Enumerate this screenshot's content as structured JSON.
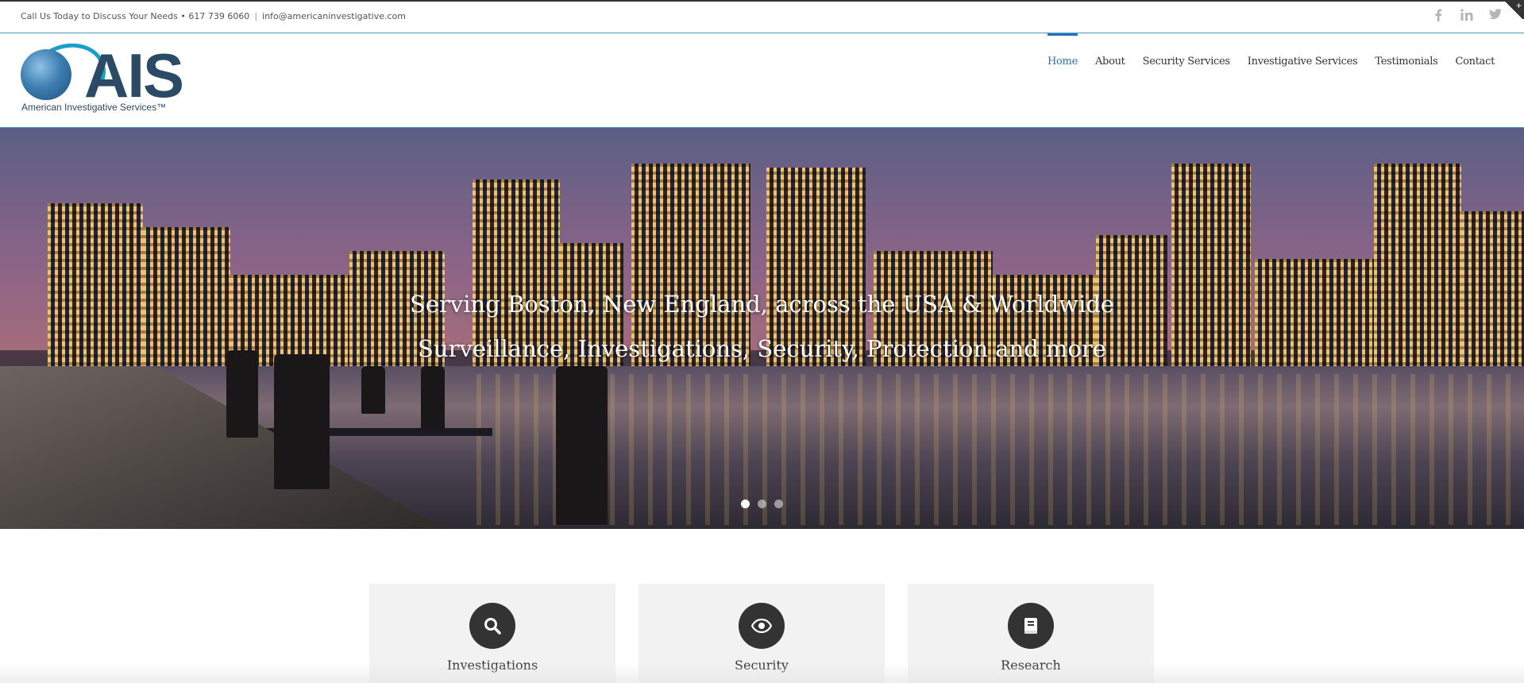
{
  "topbar": {
    "call_text": "Call Us Today to Discuss Your Needs • 617 739 6060",
    "separator": "|",
    "email": "info@americaninvestigative.com",
    "social": [
      "facebook-icon",
      "linkedin-icon",
      "twitter-icon"
    ],
    "corner_toggle": "+"
  },
  "logo": {
    "letters": "AIS",
    "tagline": "American Investigative Services™"
  },
  "nav": {
    "items": [
      {
        "label": "Home",
        "active": true
      },
      {
        "label": "About"
      },
      {
        "label": "Security Services"
      },
      {
        "label": "Investigative Services"
      },
      {
        "label": "Testimonials"
      },
      {
        "label": "Contact"
      }
    ],
    "active_color": "#2673b5"
  },
  "hero": {
    "caption_line1": "Serving Boston, New England, across the USA & Worldwide",
    "caption_line2": "Surveillance, Investigations, Security, Protection and more",
    "slides": 3,
    "active_slide": 1
  },
  "services": [
    {
      "label": "Investigations",
      "icon": "search-icon"
    },
    {
      "label": "Security",
      "icon": "eye-icon"
    },
    {
      "label": "Research",
      "icon": "book-icon"
    }
  ]
}
